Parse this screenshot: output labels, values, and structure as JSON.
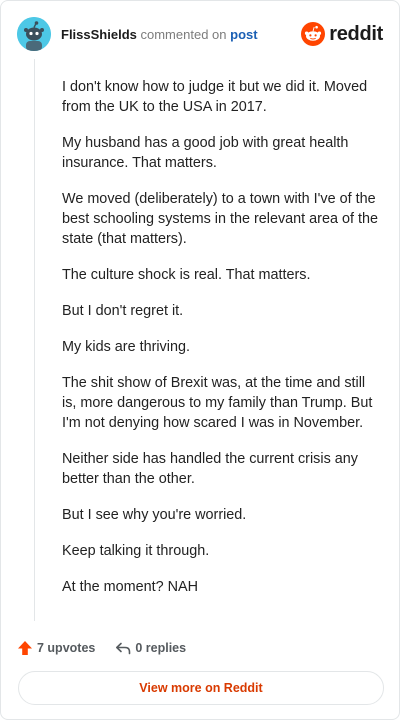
{
  "header": {
    "username": "FlissShields",
    "commented_text": "commented on",
    "post_link": "post",
    "brand_name": "reddit",
    "avatar_icon": "snoo-avatar-icon",
    "brand_icon": "reddit-logo-icon",
    "avatar_color": "#4dc8e6",
    "brand_color": "#ff4500"
  },
  "comment": {
    "paragraphs": [
      "I don't know how to judge it but we did it. Moved from the UK to the USA in 2017.",
      "My husband has a good job with great health insurance. That matters.",
      "We moved (deliberately) to a town with I've of the best schooling systems in the relevant area of the state (that matters).",
      "The culture shock is real. That matters.",
      "But I don't regret it.",
      "My kids are thriving.",
      "The shit show of Brexit was, at the time and still is, more dangerous to my family than Trump. But I'm not denying how scared I was in November.",
      "Neither side has handled the current crisis any better than the other.",
      "But I see why you're worried.",
      "Keep talking it through.",
      "At the moment? NAH"
    ]
  },
  "footer": {
    "upvotes_label": "7 upvotes",
    "replies_label": "0 replies",
    "upvote_icon": "upvote-arrow-icon",
    "reply_icon": "reply-arrow-icon",
    "upvote_color": "#ff4500"
  },
  "view_more": {
    "label": "View more on Reddit",
    "color": "#d93a00"
  }
}
